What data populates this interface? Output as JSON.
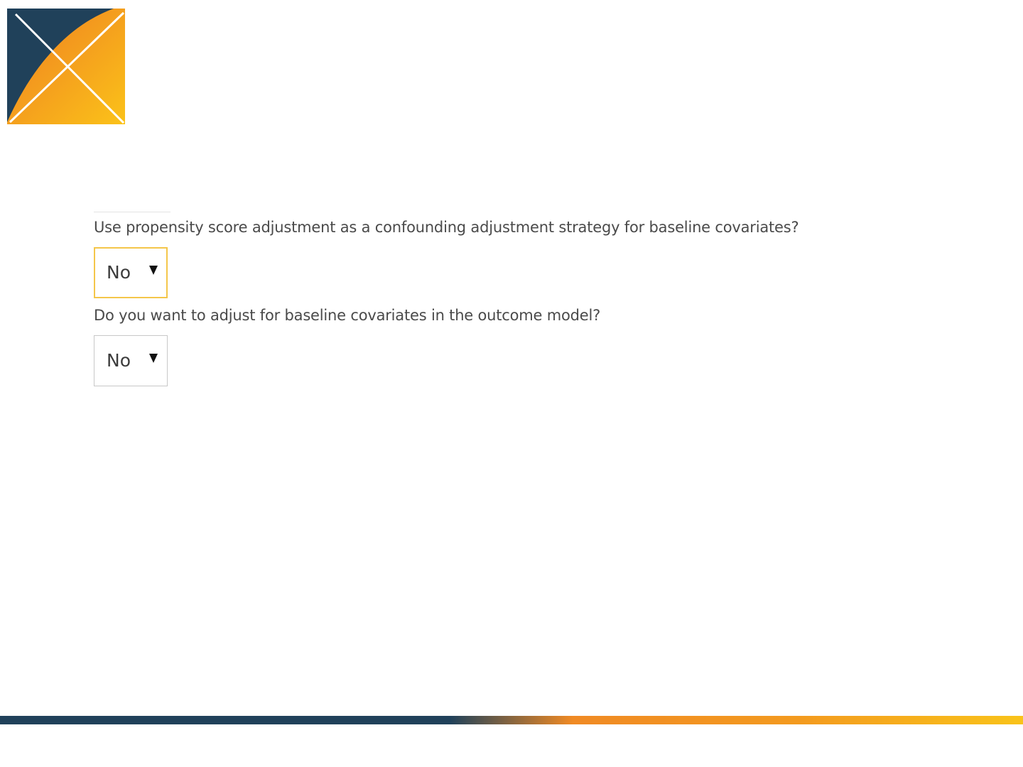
{
  "logo": {
    "icon": "ohdsi-logo-icon",
    "colors": {
      "navy": "#20415a",
      "orange": "#f08a24",
      "yellow": "#f9c31a"
    }
  },
  "form": {
    "questions": [
      {
        "label": "Use propensity score adjustment as a confounding adjustment strategy for baseline covariates?",
        "selected": "No",
        "focused": true
      },
      {
        "label": "Do you want to adjust for baseline covariates in the outcome model?",
        "selected": "No",
        "focused": false
      }
    ],
    "cutoff_question": ""
  },
  "colors": {
    "focus_border": "#f4c64a",
    "default_border": "#c8c8c8",
    "footer_gradient": [
      "#20415a",
      "#f08a24",
      "#f9c31a"
    ]
  }
}
